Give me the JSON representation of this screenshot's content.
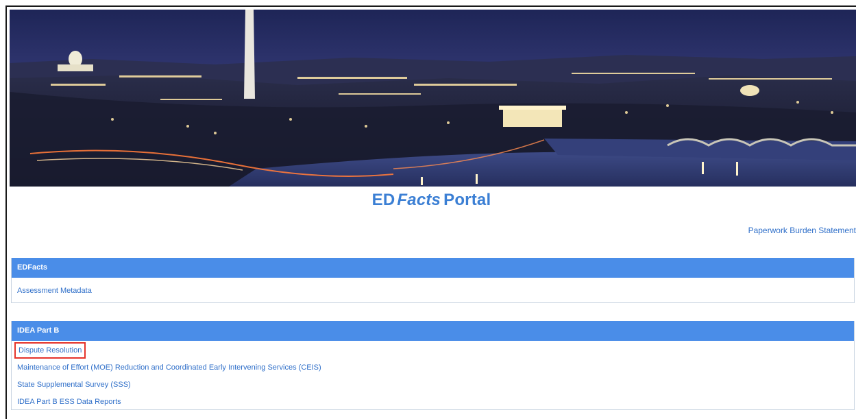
{
  "banner": {
    "alt": "Washington DC skyline at dusk"
  },
  "header": {
    "title_prefix": "ED",
    "title_italic": "Facts",
    "title_suffix": "Portal",
    "paperwork_link": "Paperwork Burden Statement"
  },
  "sections": [
    {
      "title": "EDFacts",
      "items": [
        "Assessment Metadata"
      ]
    },
    {
      "title": "IDEA Part B",
      "items": [
        "Dispute Resolution",
        "Maintenance of Effort (MOE) Reduction and Coordinated Early Intervening Services (CEIS)",
        "State Supplemental Survey (SSS)",
        "IDEA Part B ESS Data Reports"
      ]
    }
  ],
  "colors": {
    "accent": "#4a8de8",
    "link": "#2f6fc9",
    "highlight": "#e5332a"
  }
}
